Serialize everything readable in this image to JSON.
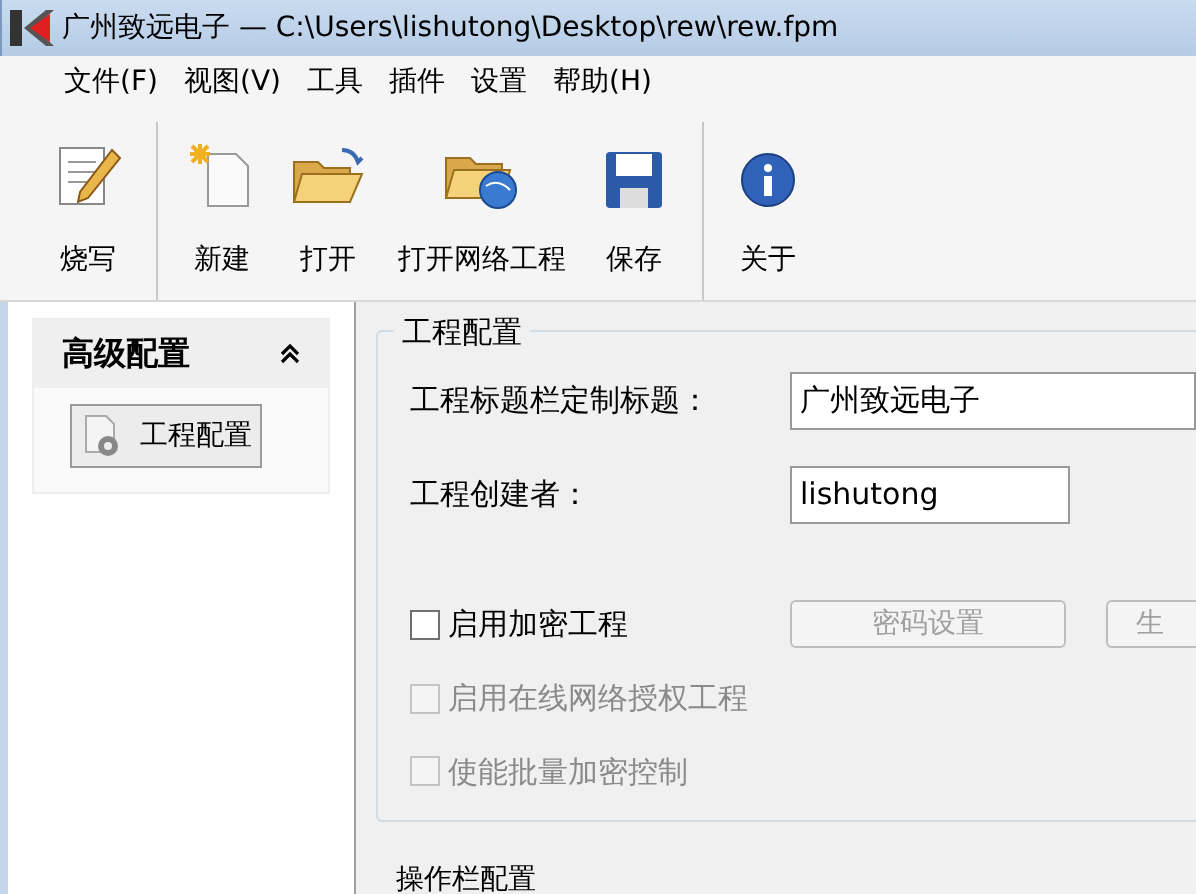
{
  "window": {
    "title": "广州致远电子 — C:\\Users\\lishutong\\Desktop\\rew\\rew.fpm"
  },
  "menu": [
    "文件(F)",
    "视图(V)",
    "工具",
    "插件",
    "设置",
    "帮助(H)"
  ],
  "toolbar": [
    [
      {
        "kind": "burn",
        "label": "烧写"
      }
    ],
    [
      {
        "kind": "new",
        "label": "新建"
      },
      {
        "kind": "open",
        "label": "打开"
      },
      {
        "kind": "network",
        "label": "打开网络工程"
      },
      {
        "kind": "save",
        "label": "保存"
      }
    ],
    [
      {
        "kind": "about",
        "label": "关于"
      }
    ]
  ],
  "sidebar": {
    "title": "高级配置",
    "items": [
      {
        "label": "工程配置",
        "selected": true
      }
    ]
  },
  "group": {
    "title": "工程配置",
    "fields": [
      {
        "label": "工程标题栏定制标题：",
        "value": "广州致远电子"
      },
      {
        "label": "工程创建者：",
        "value": "lishutong"
      }
    ],
    "encrypt": {
      "label": "启用加密工程",
      "checked": false,
      "disabled": false
    },
    "buttons": [
      {
        "label": "密码设置",
        "disabled": true
      },
      {
        "label": "生",
        "disabled": true
      }
    ],
    "options": [
      {
        "label": "启用在线网络授权工程",
        "checked": false,
        "disabled": true
      },
      {
        "label": "使能批量加密控制",
        "checked": false,
        "disabled": true
      }
    ]
  },
  "next_section": {
    "title": "操作栏配置"
  }
}
